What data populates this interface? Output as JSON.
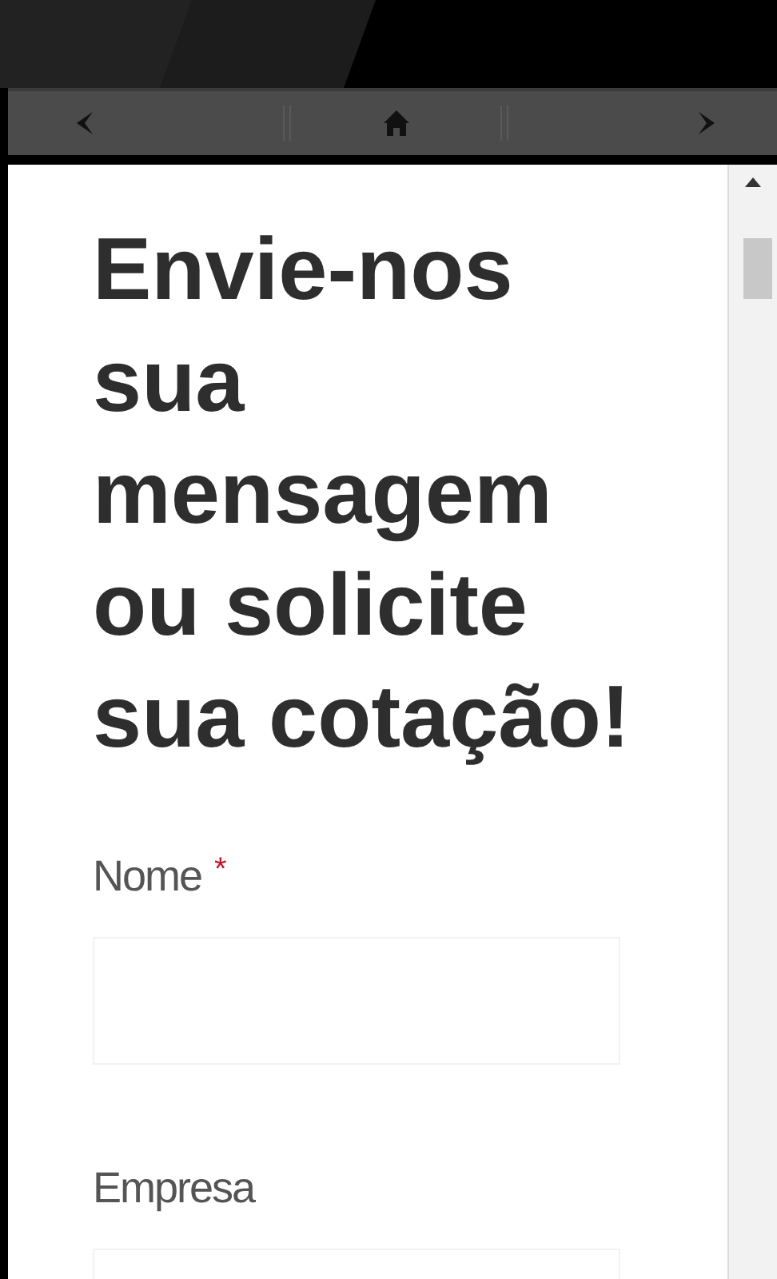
{
  "heading": "Envie-nos sua mensagem ou solicite sua cotação!",
  "fields": [
    {
      "label": "Nome",
      "required_mark": "*"
    },
    {
      "label": "Empresa"
    }
  ]
}
